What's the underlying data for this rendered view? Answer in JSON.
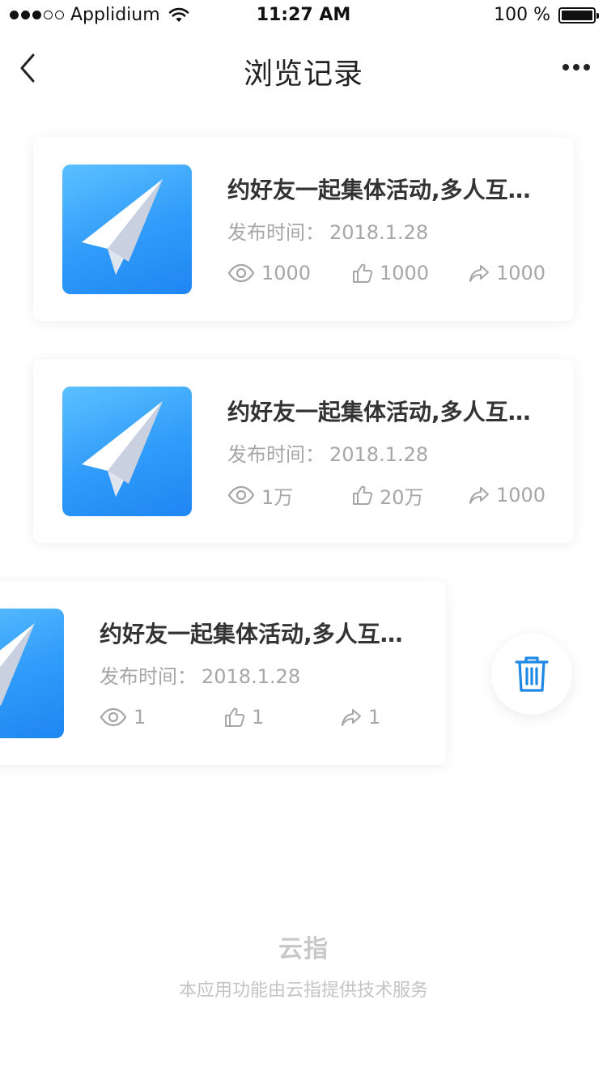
{
  "status_bar": {
    "carrier": "Applidium",
    "time": "11:27 AM",
    "battery": "100 %"
  },
  "nav": {
    "title": "浏览记录"
  },
  "cards": [
    {
      "title": "约好友一起集体活动,多人互动活动",
      "date_label": "发布时间：",
      "date": "2018.1.28",
      "views": "1000",
      "likes": "1000",
      "shares": "1000"
    },
    {
      "title": "约好友一起集体活动,多人互动活动",
      "date_label": "发布时间：",
      "date": "2018.1.28",
      "views": "1万",
      "likes": "20万",
      "shares": "1000"
    },
    {
      "title": "约好友一起集体活动,多人互动活动",
      "date_label": "发布时间：",
      "date": "2018.1.28",
      "views": "1",
      "likes": "1",
      "shares": "1"
    }
  ],
  "footer": {
    "logo": "云指",
    "text": "本应用功能由云指提供技术服务"
  },
  "colors": {
    "accent": "#2196f3",
    "thumb_gradient_start": "#5cc0ff",
    "thumb_gradient_end": "#1f86f2",
    "muted_text": "#a6a6a6"
  },
  "icons": [
    "back-arrow-icon",
    "more-dots-icon",
    "eye-icon",
    "thumbs-up-icon",
    "share-arrow-icon",
    "trash-icon",
    "paper-plane-icon"
  ]
}
